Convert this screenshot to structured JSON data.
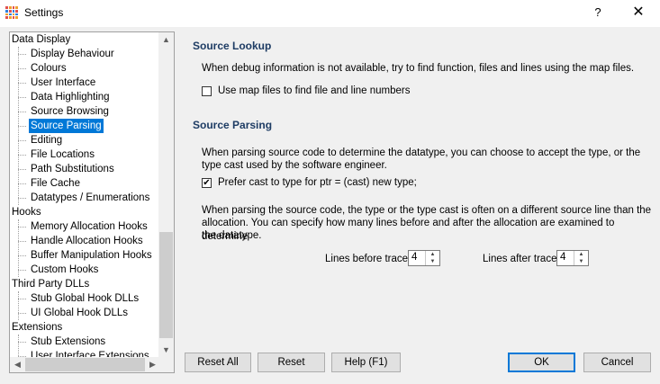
{
  "window": {
    "title": "Settings",
    "help_label": "?",
    "close_label": "✕"
  },
  "tree": {
    "items": [
      {
        "label": "Data Display",
        "level": 1
      },
      {
        "label": "Display Behaviour",
        "level": 2
      },
      {
        "label": "Colours",
        "level": 2
      },
      {
        "label": "User Interface",
        "level": 2
      },
      {
        "label": "Data Highlighting",
        "level": 2
      },
      {
        "label": "Source Browsing",
        "level": 2
      },
      {
        "label": "Source Parsing",
        "level": 2,
        "selected": true
      },
      {
        "label": "Editing",
        "level": 2
      },
      {
        "label": "File Locations",
        "level": 2
      },
      {
        "label": "Path Substitutions",
        "level": 2
      },
      {
        "label": "File Cache",
        "level": 2
      },
      {
        "label": "Datatypes / Enumerations",
        "level": 2
      },
      {
        "label": "Hooks",
        "level": 1
      },
      {
        "label": "Memory Allocation Hooks",
        "level": 2
      },
      {
        "label": "Handle Allocation Hooks",
        "level": 2
      },
      {
        "label": "Buffer Manipulation Hooks",
        "level": 2
      },
      {
        "label": "Custom Hooks",
        "level": 2
      },
      {
        "label": "Third Party DLLs",
        "level": 1
      },
      {
        "label": "Stub Global Hook DLLs",
        "level": 2
      },
      {
        "label": "UI Global Hook DLLs",
        "level": 2
      },
      {
        "label": "Extensions",
        "level": 1
      },
      {
        "label": "Stub Extensions",
        "level": 2
      },
      {
        "label": "User Interface Extensions",
        "level": 2
      }
    ]
  },
  "source_lookup": {
    "title": "Source Lookup",
    "description": "When debug information is not available, try to find function, files and lines using the map files.",
    "use_map_files_label": "Use map files to find file and line numbers",
    "use_map_files_checked": false
  },
  "source_parsing": {
    "title": "Source Parsing",
    "desc1_line1": "When parsing source code to determine the datatype, you can choose to accept the type, or the",
    "desc1_line2": "type cast used by the software engineer.",
    "prefer_cast_label": "Prefer cast to type for ptr = (cast) new type;",
    "prefer_cast_checked": true,
    "check_mark": "✔",
    "desc2_line1": "When parsing the source code, the type or the type cast is often on a different source line than the",
    "desc2_line2": "allocation. You can specify how many lines before and after the allocation are examined to determine",
    "desc2_line3": " the datatype.",
    "lines_before_label": "Lines before trace",
    "lines_before_value": "4",
    "lines_after_label": "Lines after trace",
    "lines_after_value": "4"
  },
  "buttons": {
    "reset_all": "Reset All",
    "reset": "Reset",
    "help": "Help (F1)",
    "ok": "OK",
    "cancel": "Cancel"
  },
  "colors": {
    "selection": "#0078d7",
    "section_title": "#1e3c64"
  }
}
